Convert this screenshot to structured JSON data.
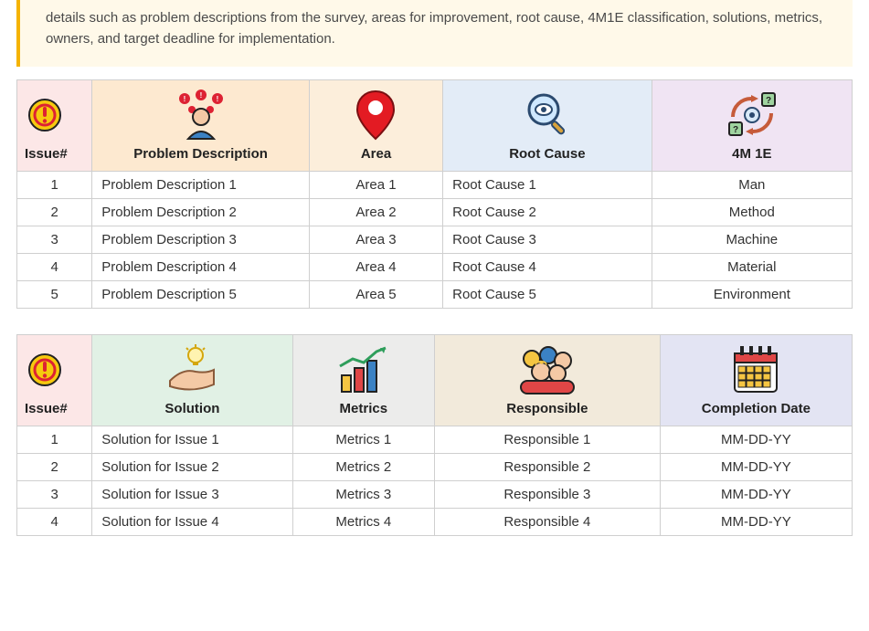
{
  "intro": "details such as problem descriptions from the survey, areas for improvement, root cause, 4M1E classification, solutions, metrics, owners, and target deadline for implementation.",
  "table1": {
    "headers": {
      "issue": "Issue#",
      "problem": "Problem Description",
      "area": "Area",
      "root": "Root Cause",
      "m4e1": "4M 1E"
    },
    "rows": [
      {
        "n": "1",
        "problem": "Problem Description 1",
        "area": "Area 1",
        "root": "Root Cause 1",
        "m4e1": "Man"
      },
      {
        "n": "2",
        "problem": "Problem Description 2",
        "area": "Area 2",
        "root": "Root Cause 2",
        "m4e1": "Method"
      },
      {
        "n": "3",
        "problem": "Problem Description 3",
        "area": "Area 3",
        "root": "Root Cause 3",
        "m4e1": "Machine"
      },
      {
        "n": "4",
        "problem": "Problem Description 4",
        "area": "Area 4",
        "root": "Root Cause 4",
        "m4e1": "Material"
      },
      {
        "n": "5",
        "problem": "Problem Description 5",
        "area": "Area 5",
        "root": "Root Cause 5",
        "m4e1": "Environment"
      }
    ]
  },
  "table2": {
    "headers": {
      "issue": "Issue#",
      "solution": "Solution",
      "metrics": "Metrics",
      "responsible": "Responsible",
      "completion": "Completion Date"
    },
    "rows": [
      {
        "n": "1",
        "solution": "Solution for Issue 1",
        "metrics": "Metrics 1",
        "responsible": "Responsible 1",
        "completion": "MM-DD-YY"
      },
      {
        "n": "2",
        "solution": "Solution for Issue 2",
        "metrics": "Metrics 2",
        "responsible": "Responsible 2",
        "completion": "MM-DD-YY"
      },
      {
        "n": "3",
        "solution": "Solution for Issue 3",
        "metrics": "Metrics 3",
        "responsible": "Responsible 3",
        "completion": "MM-DD-YY"
      },
      {
        "n": "4",
        "solution": "Solution for Issue 4",
        "metrics": "Metrics 4",
        "responsible": "Responsible 4",
        "completion": "MM-DD-YY"
      }
    ]
  }
}
